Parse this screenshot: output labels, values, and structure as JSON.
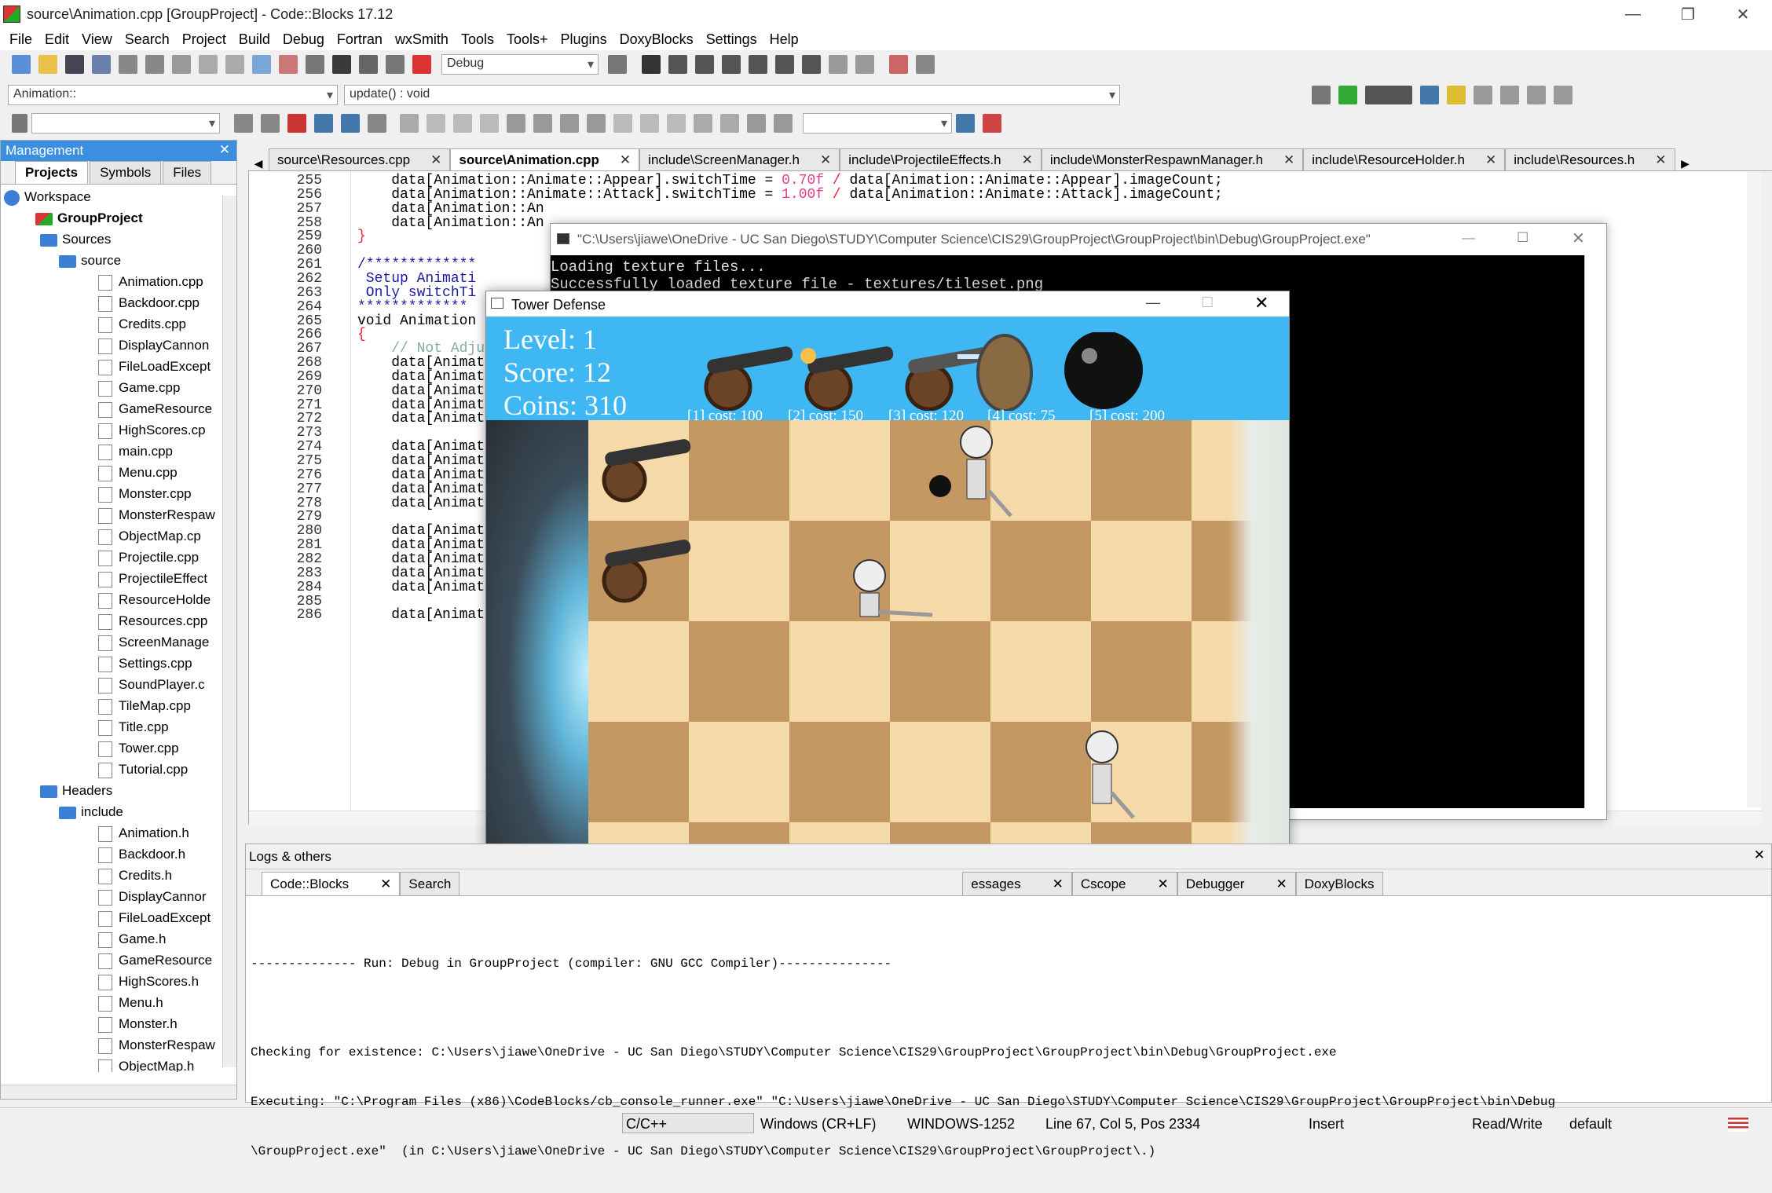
{
  "window": {
    "title": "source\\Animation.cpp [GroupProject] - Code::Blocks 17.12",
    "min": "—",
    "max": "❐",
    "close": "✕"
  },
  "menu": [
    "File",
    "Edit",
    "View",
    "Search",
    "Project",
    "Build",
    "Debug",
    "Fortran",
    "wxSmith",
    "Tools",
    "Tools+",
    "Plugins",
    "DoxyBlocks",
    "Settings",
    "Help"
  ],
  "toolbar": {
    "build_target": "Debug",
    "scope": "Animation::",
    "function": "update() : void"
  },
  "management": {
    "title": "Management",
    "close": "✕",
    "tabs": [
      "Projects",
      "Symbols",
      "Files"
    ],
    "tree": {
      "workspace": "Workspace",
      "project": "GroupProject",
      "sources": "Sources",
      "source": "source",
      "source_files": [
        "Animation.cpp",
        "Backdoor.cpp",
        "Credits.cpp",
        "DisplayCannon",
        "FileLoadExcept",
        "Game.cpp",
        "GameResource",
        "HighScores.cp",
        "main.cpp",
        "Menu.cpp",
        "Monster.cpp",
        "MonsterRespaw",
        "ObjectMap.cp",
        "Projectile.cpp",
        "ProjectileEffect",
        "ResourceHolde",
        "Resources.cpp",
        "ScreenManage",
        "Settings.cpp",
        "SoundPlayer.c",
        "TileMap.cpp",
        "Title.cpp",
        "Tower.cpp",
        "Tutorial.cpp"
      ],
      "headers": "Headers",
      "include": "include",
      "header_files": [
        "Animation.h",
        "Backdoor.h",
        "Credits.h",
        "DisplayCannor",
        "FileLoadExcept",
        "Game.h",
        "GameResource",
        "HighScores.h",
        "Menu.h",
        "Monster.h",
        "MonsterRespaw",
        "ObjectMap.h"
      ]
    }
  },
  "editor_tabs": [
    {
      "label": "source\\Resources.cpp",
      "close": "✕"
    },
    {
      "label": "source\\Animation.cpp",
      "close": "✕"
    },
    {
      "label": "include\\ScreenManager.h",
      "close": "✕"
    },
    {
      "label": "include\\ProjectileEffects.h",
      "close": "✕"
    },
    {
      "label": "include\\MonsterRespawnManager.h",
      "close": "✕"
    },
    {
      "label": "include\\ResourceHolder.h",
      "close": "✕"
    },
    {
      "label": "include\\Resources.h",
      "close": "✕"
    }
  ],
  "code": {
    "line_numbers": [
      "255",
      "256",
      "257",
      "258",
      "259",
      "260",
      "261",
      "262",
      "263",
      "264",
      "265",
      "266",
      "267",
      "268",
      "269",
      "270",
      "271",
      "272",
      "273",
      "274",
      "275",
      "276",
      "277",
      "278",
      "279",
      "280",
      "281",
      "282",
      "283",
      "284",
      "285",
      "286"
    ],
    "l255a": "    data[Animation::Animate::Appear].switchTime = ",
    "l255n": "0.70f",
    "l255o": " / ",
    "l255b": "data[Animation::Animate::Appear].imageCount;",
    "l256a": "    data[Animation::Animate::Attack].switchTime = ",
    "l256n": "1.00f",
    "l256o": " / ",
    "l256b": "data[Animation::Animate::Attack].imageCount;",
    "l257": "    data[Animation::An",
    "l258": "    data[Animation::An",
    "l259": "}",
    "l261": "/*************",
    "l262": " Setup Animati",
    "l263": " Only switchTi",
    "l264": "*************",
    "l265": "void Animation",
    "l266": "{",
    "l267": "    // Not Adju",
    "data_line": "    data[Animat"
  },
  "console": {
    "title": "\"C:\\Users\\jiawe\\OneDrive - UC San Diego\\STUDY\\Computer Science\\CIS29\\GroupProject\\GroupProject\\bin\\Debug\\GroupProject.exe\"",
    "line1": "Loading texture files...",
    "line2": "Successfully loaded texture file - textures/tileset.png"
  },
  "game": {
    "title": "Tower Defense",
    "level": "Level: 1",
    "score": "Score: 12",
    "coins": "Coins: 310",
    "costs": [
      "[1] cost: 100",
      "[2] cost: 150",
      "[3] cost: 120",
      "[4] cost: 75",
      "[5] cost: 200"
    ]
  },
  "logs": {
    "title": "Logs & others",
    "close": "✕",
    "tabs": [
      "Code::Blocks",
      "Search",
      "essages",
      "Cscope",
      "Debugger",
      "DoxyBlocks"
    ],
    "line1": "-------------- Run: Debug in GroupProject (compiler: GNU GCC Compiler)---------------",
    "line2": "Checking for existence: C:\\Users\\jiawe\\OneDrive - UC San Diego\\STUDY\\Computer Science\\CIS29\\GroupProject\\GroupProject\\bin\\Debug\\GroupProject.exe",
    "line3": "Executing: \"C:\\Program Files (x86)\\CodeBlocks/cb_console_runner.exe\" \"C:\\Users\\jiawe\\OneDrive - UC San Diego\\STUDY\\Computer Science\\CIS29\\GroupProject\\GroupProject\\bin\\Debug",
    "line4": "\\GroupProject.exe\"  (in C:\\Users\\jiawe\\OneDrive - UC San Diego\\STUDY\\Computer Science\\CIS29\\GroupProject\\GroupProject\\.)"
  },
  "status": {
    "lang": "C/C++",
    "eol": "Windows (CR+LF)",
    "enc": "WINDOWS-1252",
    "pos": "Line 67, Col 5, Pos 2334",
    "mode": "Insert",
    "rw": "Read/Write",
    "profile": "default"
  }
}
